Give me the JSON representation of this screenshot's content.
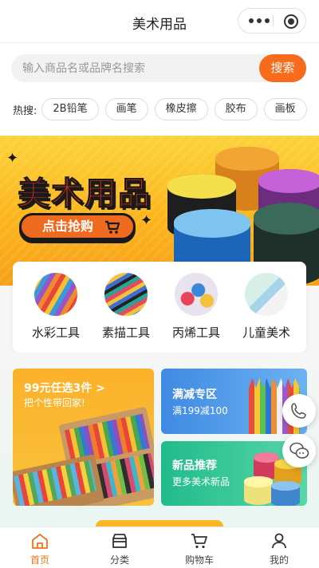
{
  "header": {
    "title": "美术用品"
  },
  "search": {
    "placeholder": "输入商品名或品牌名搜索",
    "button_label": "搜索"
  },
  "hot_search": {
    "label": "热搜:",
    "tags": [
      "2B铅笔",
      "画笔",
      "橡皮擦",
      "胶布",
      "画板"
    ]
  },
  "banner": {
    "headline": "美术用品",
    "cta_label": "点击抢购"
  },
  "categories": [
    {
      "name": "水彩工具"
    },
    {
      "name": "素描工具"
    },
    {
      "name": "丙烯工具"
    },
    {
      "name": "儿童美术"
    }
  ],
  "promos": {
    "left": {
      "title": "99元任选3件 >",
      "subtitle": "把个性带回家!"
    },
    "right_top": {
      "title": "满减专区",
      "subtitle": "满199减100"
    },
    "right_bottom": {
      "title": "新品推荐",
      "subtitle": "更多美术新品"
    }
  },
  "tabbar": {
    "items": [
      {
        "label": "首页",
        "icon": "home-icon",
        "active": true
      },
      {
        "label": "分类",
        "icon": "category-icon",
        "active": false
      },
      {
        "label": "购物车",
        "icon": "cart-icon",
        "active": false
      },
      {
        "label": "我的",
        "icon": "user-icon",
        "active": false
      }
    ]
  },
  "colors": {
    "accent": "#f86a1c",
    "active_tab": "#f0721d",
    "banner_yellow": "#fcb51c",
    "promo_blue": "#4f97ea",
    "promo_green": "#2ec492"
  }
}
